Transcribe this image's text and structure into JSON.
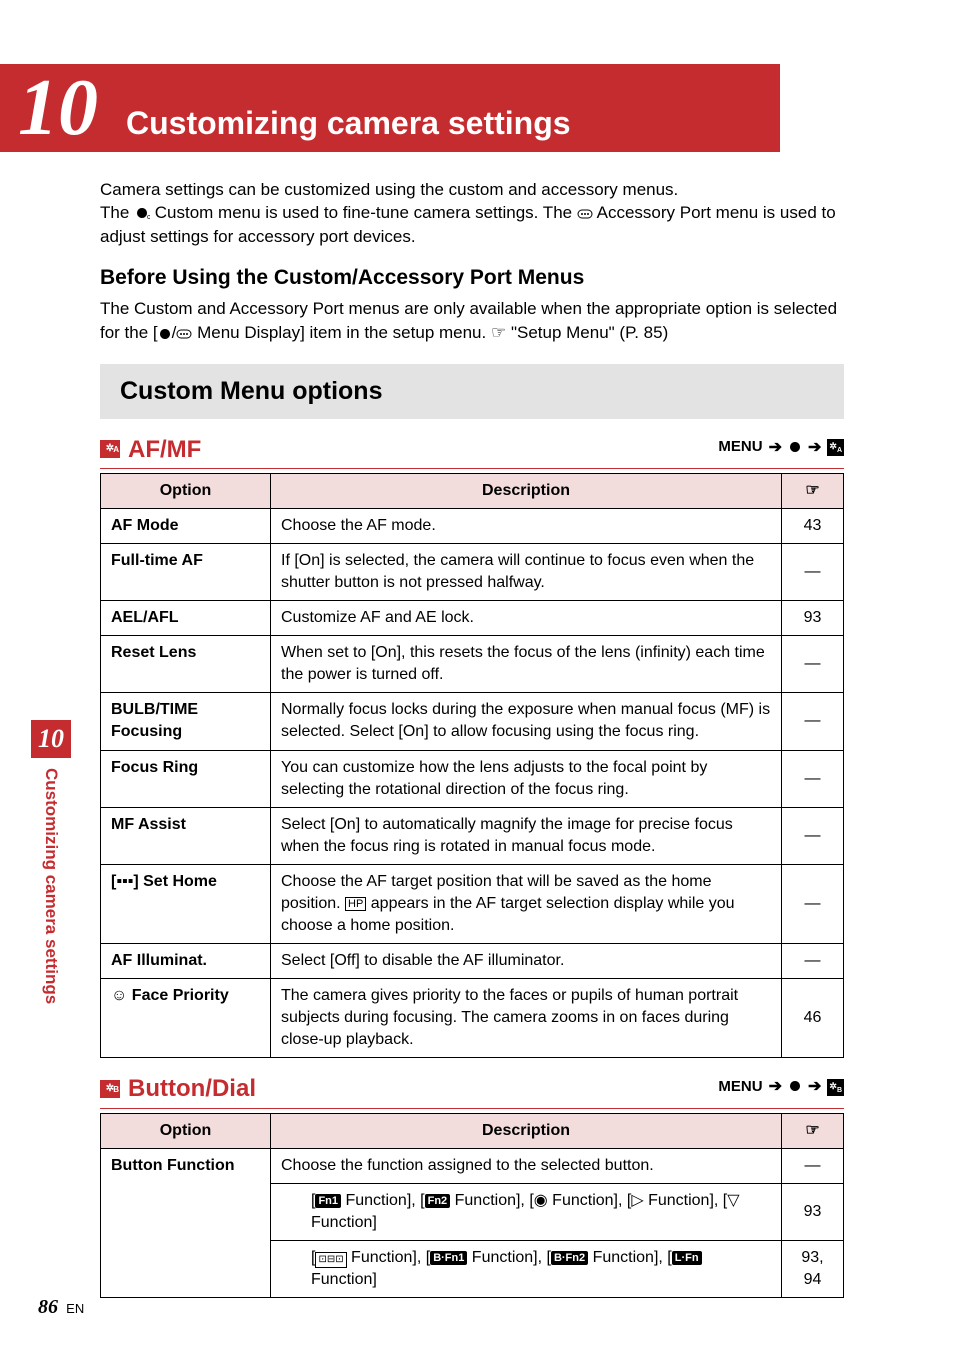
{
  "chapter": {
    "number": "10",
    "title": "Customizing camera settings"
  },
  "intro": {
    "line1a": "Camera settings can be customized using the custom and accessory menus.",
    "line1b_pre": "The ",
    "line1b_mid": " Custom menu is used to fine-tune camera settings. The ",
    "line1b_post": " Accessory Port menu is used to adjust settings for accessory port devices."
  },
  "before": {
    "title": "Before Using the Custom/Accessory Port Menus",
    "body_pre": "The Custom and Accessory Port menus are only available when the appropriate option is selected for the [",
    "body_mid": " Menu Display] item in the setup menu. ",
    "body_ref": " \"Setup Menu\" (P. 85)"
  },
  "banner": "Custom Menu options",
  "sectionA": {
    "tag": "A",
    "title": "AF/MF",
    "menu_label": "MENU"
  },
  "sectionB": {
    "tag": "B",
    "title": "Button/Dial",
    "menu_label": "MENU"
  },
  "tableHeaders": {
    "option": "Option",
    "description": "Description",
    "ref": "☞"
  },
  "tableA": [
    {
      "opt": "AF Mode",
      "desc": "Choose the AF mode.",
      "ref": "43"
    },
    {
      "opt": "Full-time AF",
      "desc": "If [On] is selected, the camera will continue to focus even when the shutter button is not pressed halfway.",
      "ref": "—"
    },
    {
      "opt": "AEL/AFL",
      "desc": "Customize AF and AE lock.",
      "ref": "93"
    },
    {
      "opt": "Reset Lens",
      "desc": "When set to [On], this resets the focus of the lens (infinity) each time the power is turned off.",
      "ref": "—"
    },
    {
      "opt": "BULB/TIME Focusing",
      "desc": "Normally focus locks during the exposure when manual focus (MF) is selected. Select [On] to allow focusing using the focus ring.",
      "ref": "—"
    },
    {
      "opt": "Focus Ring",
      "desc": "You can customize how the lens adjusts to the focal point by selecting the rotational direction of the focus ring.",
      "ref": "—"
    },
    {
      "opt": "MF Assist",
      "desc": "Select [On] to automatically magnify the image for precise focus when the focus ring is rotated in manual focus mode.",
      "ref": "—"
    },
    {
      "opt_html": true,
      "opt": "[···] Set Home",
      "desc_pre": "Choose the AF target position that will be saved as the home position. ",
      "desc_hp": "HP",
      "desc_post": " appears in the AF target selection display while you choose a home position.",
      "ref": "—"
    },
    {
      "opt": "AF Illuminat.",
      "desc": "Select [Off] to disable the AF illuminator.",
      "ref": "—"
    },
    {
      "opt_face": true,
      "opt": " Face Priority",
      "desc": "The camera gives priority to the faces or pupils of human portrait subjects during focusing. The camera zooms in on faces during close-up playback.",
      "ref": "46"
    }
  ],
  "tableB": {
    "row1": {
      "opt": "Button Function",
      "desc": "Choose the function assigned to the selected button.",
      "ref": "—"
    },
    "row2": {
      "parts": [
        "Fn1",
        " Function], [",
        "Fn2",
        " Function], [",
        "rec",
        " Function], [",
        "right",
        " Function], [",
        "down",
        " Function]"
      ],
      "ref": "93"
    },
    "row3": {
      "parts": [
        "grip",
        " Function], [",
        "BFn1",
        " Function], [",
        "BFn2",
        " Function], [",
        "LFn",
        " Function]"
      ],
      "ref": "93, 94"
    }
  },
  "sidebar": {
    "num": "10",
    "text": "Customizing camera settings"
  },
  "footer": {
    "page": "86",
    "lang": "EN"
  }
}
